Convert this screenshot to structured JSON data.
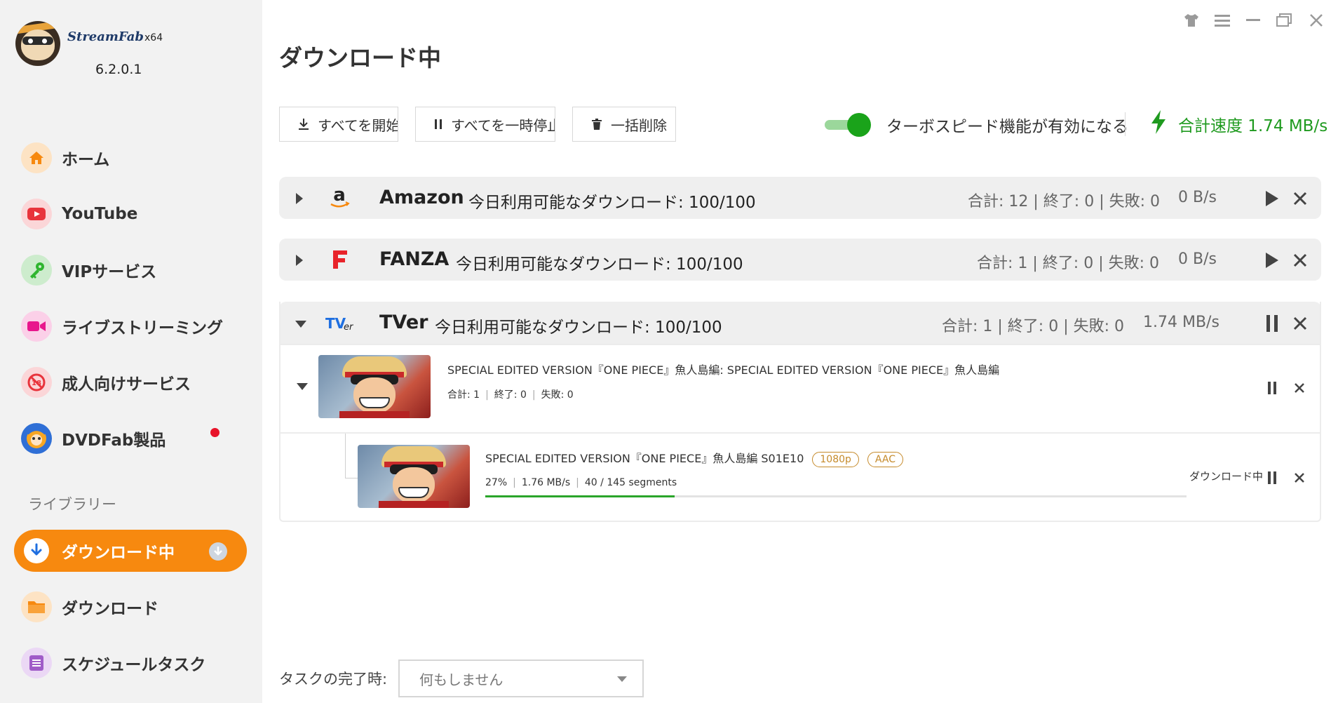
{
  "app": {
    "name": "StreamFab",
    "arch": "x64",
    "version": "6.2.0.1"
  },
  "sidebar": {
    "items": [
      {
        "label": "ホーム",
        "icon": "home-icon",
        "color": "#f7890f"
      },
      {
        "label": "YouTube",
        "icon": "youtube-icon",
        "color": "#e8343c"
      },
      {
        "label": "VIPサービス",
        "icon": "key-icon",
        "color": "#2fb52f"
      },
      {
        "label": "ライブストリーミング",
        "icon": "camera-icon",
        "color": "#e8168c"
      },
      {
        "label": "成人向けサービス",
        "icon": "adult-content-icon",
        "color": "#e8343c"
      },
      {
        "label": "DVDFab製品",
        "icon": "dvdfab-logo-icon",
        "color": "#2f6fd6"
      }
    ],
    "library_title": "ライブラリー",
    "library": [
      {
        "label": "ダウンロード中",
        "icon": "download-arrow-icon",
        "active": true
      },
      {
        "label": "ダウンロード",
        "icon": "folder-icon",
        "color": "#f7890f"
      },
      {
        "label": "スケジュールタスク",
        "icon": "schedule-list-icon",
        "color": "#a05cc8"
      }
    ]
  },
  "main": {
    "title": "ダウンロード中",
    "toolbar": {
      "start_all": "すべてを開始",
      "pause_all": "すべてを一時停止",
      "delete_all": "一括削除"
    },
    "turbo": {
      "enabled": true,
      "label": "ターボスピード機能が有効になる"
    },
    "total_speed": "合計速度 1.74 MB/s",
    "accent_green": "#1f9a1f",
    "accent_orange": "#f7890f",
    "groups": [
      {
        "name": "Amazon",
        "quota": "今日利用可能なダウンロード: 100/100",
        "stats": "合計: 12 | 終了: 0 | 失敗: 0",
        "rate": "0 B/s",
        "expanded": false,
        "running": false
      },
      {
        "name": "FANZA",
        "quota": "今日利用可能なダウンロード: 100/100",
        "stats": "合計: 1 | 終了: 0 | 失敗: 0",
        "rate": "0 B/s",
        "expanded": false,
        "running": false
      },
      {
        "name": "TVer",
        "quota": "今日利用可能なダウンロード: 100/100",
        "stats": "合計: 1 | 終了: 0 | 失敗: 0",
        "rate": "1.74 MB/s",
        "expanded": true,
        "running": true
      }
    ],
    "task": {
      "title": "SPECIAL EDITED VERSION『ONE PIECE』魚人島編: SPECIAL EDITED VERSION『ONE PIECE』魚人島編",
      "total": "合計: 1",
      "done": "終了: 0",
      "failed": "失敗: 0"
    },
    "subtask": {
      "title": "SPECIAL EDITED VERSION『ONE PIECE』魚人島編 S01E10",
      "quality_tag": "1080p",
      "audio_tag": "AAC",
      "percent_text": "27%",
      "progress": 0.27,
      "speed": "1.76 MB/s",
      "segments": "40 / 145 segments",
      "status": "ダウンロード中"
    },
    "footer": {
      "label": "タスクの完了時:",
      "select_value": "何もしません"
    }
  }
}
